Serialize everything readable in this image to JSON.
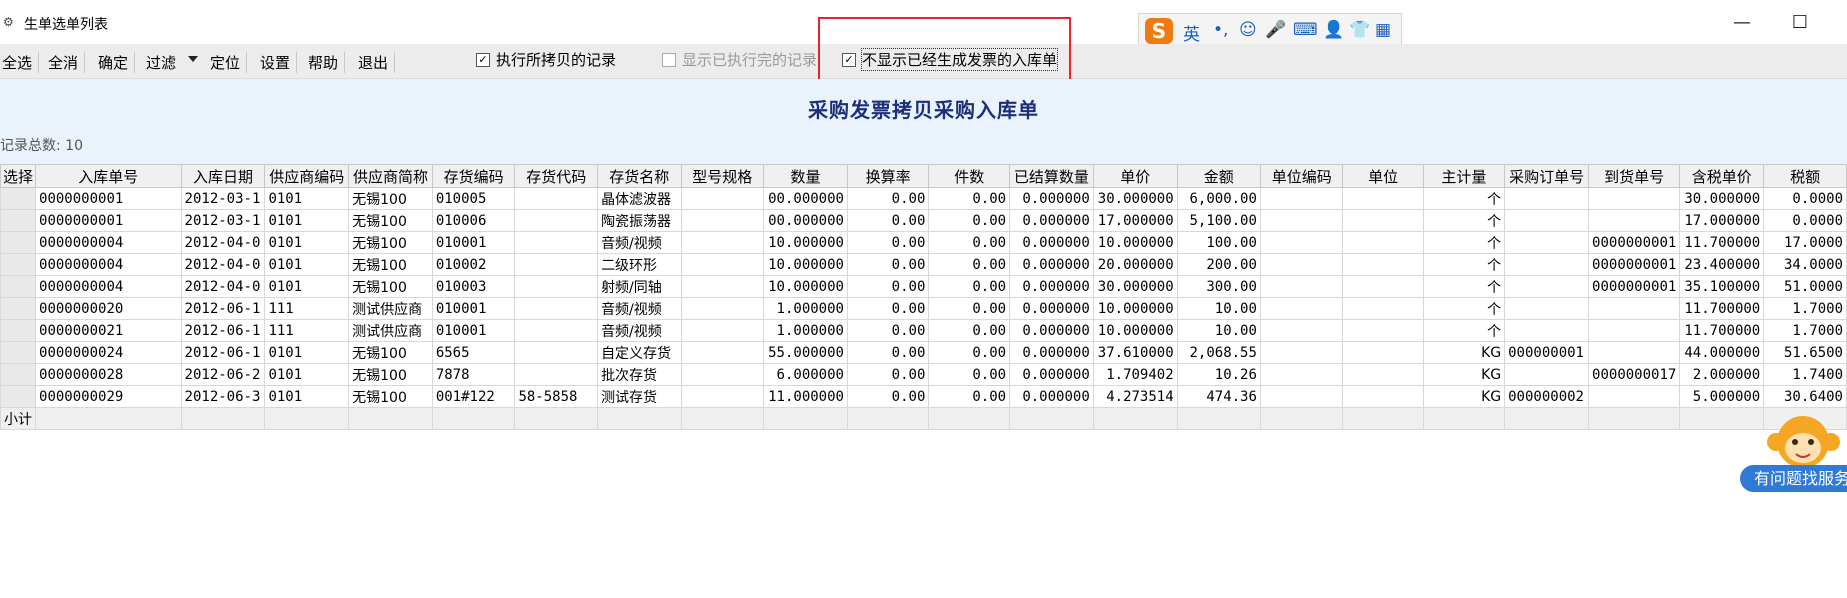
{
  "window": {
    "title": "生单选单列表",
    "minimize_glyph": "—",
    "maximize_glyph": "☐"
  },
  "toolbar": {
    "buttons": [
      "全选",
      "全消",
      "确定",
      "过滤",
      "定位",
      "设置",
      "帮助",
      "退出"
    ],
    "checkboxes": [
      {
        "label": "执行所拷贝的记录",
        "checked": true,
        "enabled": true
      },
      {
        "label": "显示已执行完的记录",
        "checked": false,
        "enabled": false
      },
      {
        "label": "不显示已经生成发票的入库单",
        "checked": true,
        "enabled": true
      }
    ]
  },
  "ime": {
    "logo": "S",
    "items": [
      "英",
      "•,",
      "☺",
      "🎤",
      "⌨",
      "👤",
      "👕",
      "▦"
    ]
  },
  "page": {
    "title": "采购发票拷贝采购入库单",
    "record_count": "记录总数: 10"
  },
  "grid": {
    "columns": [
      "选择",
      "入库单号",
      "入库日期",
      "供应商编码",
      "供应商简称",
      "存货编码",
      "存货代码",
      "存货名称",
      "型号规格",
      "数量",
      "换算率",
      "件数",
      "已结算数量",
      "单价",
      "金额",
      "单位编码",
      "单位",
      "主计量",
      "采购订单号",
      "到货单号",
      "含税单价",
      "税额"
    ],
    "rows": [
      [
        "",
        "0000000001",
        "2012-03-1",
        "0101",
        "无锡100",
        "010005",
        "",
        "晶体滤波器",
        "",
        "00.000000",
        "0.00",
        "0.00",
        "0.000000",
        "30.000000",
        "6,000.00",
        "",
        "",
        "个",
        "",
        "",
        "30.000000",
        "0.0000"
      ],
      [
        "",
        "0000000001",
        "2012-03-1",
        "0101",
        "无锡100",
        "010006",
        "",
        "陶瓷振荡器",
        "",
        "00.000000",
        "0.00",
        "0.00",
        "0.000000",
        "17.000000",
        "5,100.00",
        "",
        "",
        "个",
        "",
        "",
        "17.000000",
        "0.0000"
      ],
      [
        "",
        "0000000004",
        "2012-04-0",
        "0101",
        "无锡100",
        "010001",
        "",
        "音频/视频",
        "",
        "10.000000",
        "0.00",
        "0.00",
        "0.000000",
        "10.000000",
        "100.00",
        "",
        "",
        "个",
        "",
        "0000000001",
        "11.700000",
        "17.0000"
      ],
      [
        "",
        "0000000004",
        "2012-04-0",
        "0101",
        "无锡100",
        "010002",
        "",
        "二级环形",
        "",
        "10.000000",
        "0.00",
        "0.00",
        "0.000000",
        "20.000000",
        "200.00",
        "",
        "",
        "个",
        "",
        "0000000001",
        "23.400000",
        "34.0000"
      ],
      [
        "",
        "0000000004",
        "2012-04-0",
        "0101",
        "无锡100",
        "010003",
        "",
        "射频/同轴",
        "",
        "10.000000",
        "0.00",
        "0.00",
        "0.000000",
        "30.000000",
        "300.00",
        "",
        "",
        "个",
        "",
        "0000000001",
        "35.100000",
        "51.0000"
      ],
      [
        "",
        "0000000020",
        "2012-06-1",
        "111",
        "测试供应商",
        "010001",
        "",
        "音频/视频",
        "",
        "1.000000",
        "0.00",
        "0.00",
        "0.000000",
        "10.000000",
        "10.00",
        "",
        "",
        "个",
        "",
        "",
        "11.700000",
        "1.7000"
      ],
      [
        "",
        "0000000021",
        "2012-06-1",
        "111",
        "测试供应商",
        "010001",
        "",
        "音频/视频",
        "",
        "1.000000",
        "0.00",
        "0.00",
        "0.000000",
        "10.000000",
        "10.00",
        "",
        "",
        "个",
        "",
        "",
        "11.700000",
        "1.7000"
      ],
      [
        "",
        "0000000024",
        "2012-06-1",
        "0101",
        "无锡100",
        "6565",
        "",
        "自定义存货",
        "",
        "55.000000",
        "0.00",
        "0.00",
        "0.000000",
        "37.610000",
        "2,068.55",
        "",
        "",
        "KG",
        "000000001",
        "",
        "44.000000",
        "51.6500"
      ],
      [
        "",
        "0000000028",
        "2012-06-2",
        "0101",
        "无锡100",
        "7878",
        "",
        "批次存货",
        "",
        "6.000000",
        "0.00",
        "0.00",
        "0.000000",
        "1.709402",
        "10.26",
        "",
        "",
        "KG",
        "",
        "0000000017",
        "2.000000",
        "1.7400"
      ],
      [
        "",
        "0000000029",
        "2012-06-3",
        "0101",
        "无锡100",
        "001#122",
        "58-5858",
        "测试存货",
        "",
        "11.000000",
        "0.00",
        "0.00",
        "0.000000",
        "4.273514",
        "474.36",
        "",
        "",
        "KG",
        "000000002",
        "",
        "5.000000",
        "30.6400"
      ]
    ],
    "subtotal_label": "小计"
  },
  "help_widget": {
    "label": "有问题找服务"
  },
  "colors": {
    "highlight": "#e8232c",
    "title_text": "#1b2f7a",
    "header_band": "#eaf2fb",
    "help_blue": "#2f7ad6"
  }
}
